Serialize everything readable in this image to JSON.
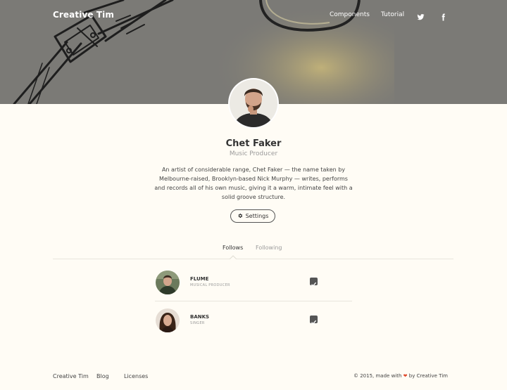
{
  "navbar": {
    "brand": "Creative Tim",
    "links": [
      {
        "label": "Components"
      },
      {
        "label": "Tutorial"
      }
    ],
    "icons": [
      "twitter-icon",
      "facebook-icon"
    ]
  },
  "profile": {
    "name": "Chet Faker",
    "role": "Music Producer",
    "bio": "An artist of considerable range, Chet Faker — the name taken by Melbourne-raised, Brooklyn-based Nick Murphy — writes, performs and records all of his own music, giving it a warm, intimate feel with a solid groove structure.",
    "settings_label": "Settings"
  },
  "tabs": [
    {
      "label": "Follows",
      "active": true
    },
    {
      "label": "Following",
      "active": false
    }
  ],
  "follows": [
    {
      "name": "FLUME",
      "subtitle": "MUSICAL PRODUCER",
      "checked": true
    },
    {
      "name": "BANKS",
      "subtitle": "SINGER",
      "checked": true
    }
  ],
  "footer": {
    "links": [
      "Creative Tim",
      "Blog",
      "Licenses"
    ],
    "copyright_prefix": "© 2015, made with",
    "heart": "❤",
    "copyright_suffix": "by Creative Tim"
  },
  "colors": {
    "background": "#fffcf5",
    "hero": "#7b7a76",
    "accent_heart": "#e0482b"
  }
}
